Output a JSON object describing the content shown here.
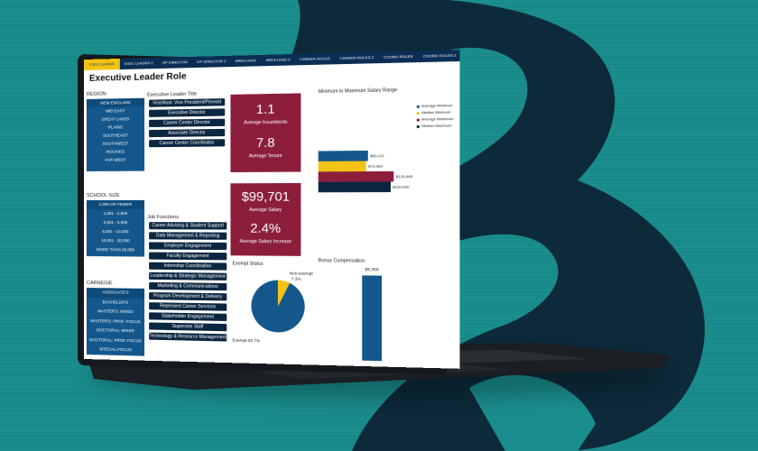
{
  "tabs": [
    "EXEC LEADER",
    "EXEC LEADER 2",
    "OP DIRECTOR",
    "OP DIRECTOR 2",
    "AREA LEAD",
    "AREA LEAD 2",
    "CAREER ROLES",
    "CAREER ROLES 2",
    "COORD ROLES",
    "COORD ROLES 2"
  ],
  "page_title": "Executive Leader Role",
  "region": {
    "label": "REGION",
    "items": [
      "NEW ENGLAND",
      "MID EAST",
      "GREAT LAKES",
      "PLAINS",
      "SOUTHEAST",
      "SOUTHWEST",
      "ROCKIES",
      "FAR WEST"
    ]
  },
  "school_size": {
    "label": "SCHOOL SIZE",
    "items": [
      "1,000 OR FEWER",
      "1,001 - 2,500",
      "2,501 - 5,000",
      "5,001 - 10,000",
      "10,001 - 20,000",
      "MORE THAN 20,000"
    ]
  },
  "carnegie": {
    "label": "CARNEGIE",
    "items": [
      "ASSOCIATE'S",
      "BACHELOR'S",
      "MASTER'S: MIXED",
      "MASTER'S: PROF. FOCUS",
      "DOCTORAL: MIXED",
      "DOCTORAL: PROF. FOCUS",
      "SPECIAL FOCUS"
    ]
  },
  "exec_title": {
    "label": "Executive Leader Title",
    "items": [
      "Vice/Asst. Vice President/Provost",
      "Executive Director",
      "Career Center Director",
      "Associate Director",
      "Career Center Coordinator"
    ]
  },
  "job_functions": {
    "label": "Job Functions",
    "items": [
      "Career Advising & Student Support",
      "Data Management & Reporting",
      "Employer Engagement",
      "Faculty Engagement",
      "Internship Coordination",
      "Leadership & Strategic Management",
      "Marketing & Communications",
      "Program Development & Delivery",
      "Represent Career Services",
      "Stakeholder Engagement",
      "Supervise Staff",
      "Technology & Resource Management"
    ]
  },
  "kpis": {
    "avg_incumbents_value": "1.1",
    "avg_incumbents_label": "Average Incumbents",
    "avg_tenure_value": "7.8",
    "avg_tenure_label": "Average Tenure",
    "avg_salary_value": "$99,701",
    "avg_salary_label": "Average Salary",
    "avg_increase_value": "2.4%",
    "avg_increase_label": "Average Salary Increase"
  },
  "colors": {
    "navy": "#0b2e55",
    "blue": "#14578c",
    "maroon": "#8c1e3c",
    "gold": "#f4c316",
    "dark": "#0b2640"
  },
  "salary_chart": {
    "title": "Minimum to Maximum Salary Range",
    "legend": [
      "Average Minimum",
      "Median Minimum",
      "Average Maximum",
      "Median Maximum"
    ],
    "values": [
      "$83,112",
      "$79,964",
      "$125,645",
      "$120,000"
    ]
  },
  "chart_data": [
    {
      "type": "bar",
      "title": "Minimum to Maximum Salary Range",
      "categories": [
        "Average Minimum",
        "Median Minimum",
        "Average Maximum",
        "Median Maximum"
      ],
      "values": [
        83112,
        79964,
        125645,
        120000
      ]
    },
    {
      "type": "pie",
      "title": "Exempt Status",
      "categories": [
        "Exempt",
        "Non-exempt"
      ],
      "values": [
        92.7,
        7.3
      ]
    },
    {
      "type": "bar",
      "title": "Bonus Compensation",
      "categories": [
        ""
      ],
      "values": [
        5359
      ]
    }
  ],
  "exempt": {
    "title": "Exempt Status",
    "nonexempt_label": "Non-exempt",
    "nonexempt_pct": "7.3%",
    "exempt_label": "Exempt 92.7%"
  },
  "bonus": {
    "title": "Bonus Compensation",
    "value": "$5,359"
  }
}
